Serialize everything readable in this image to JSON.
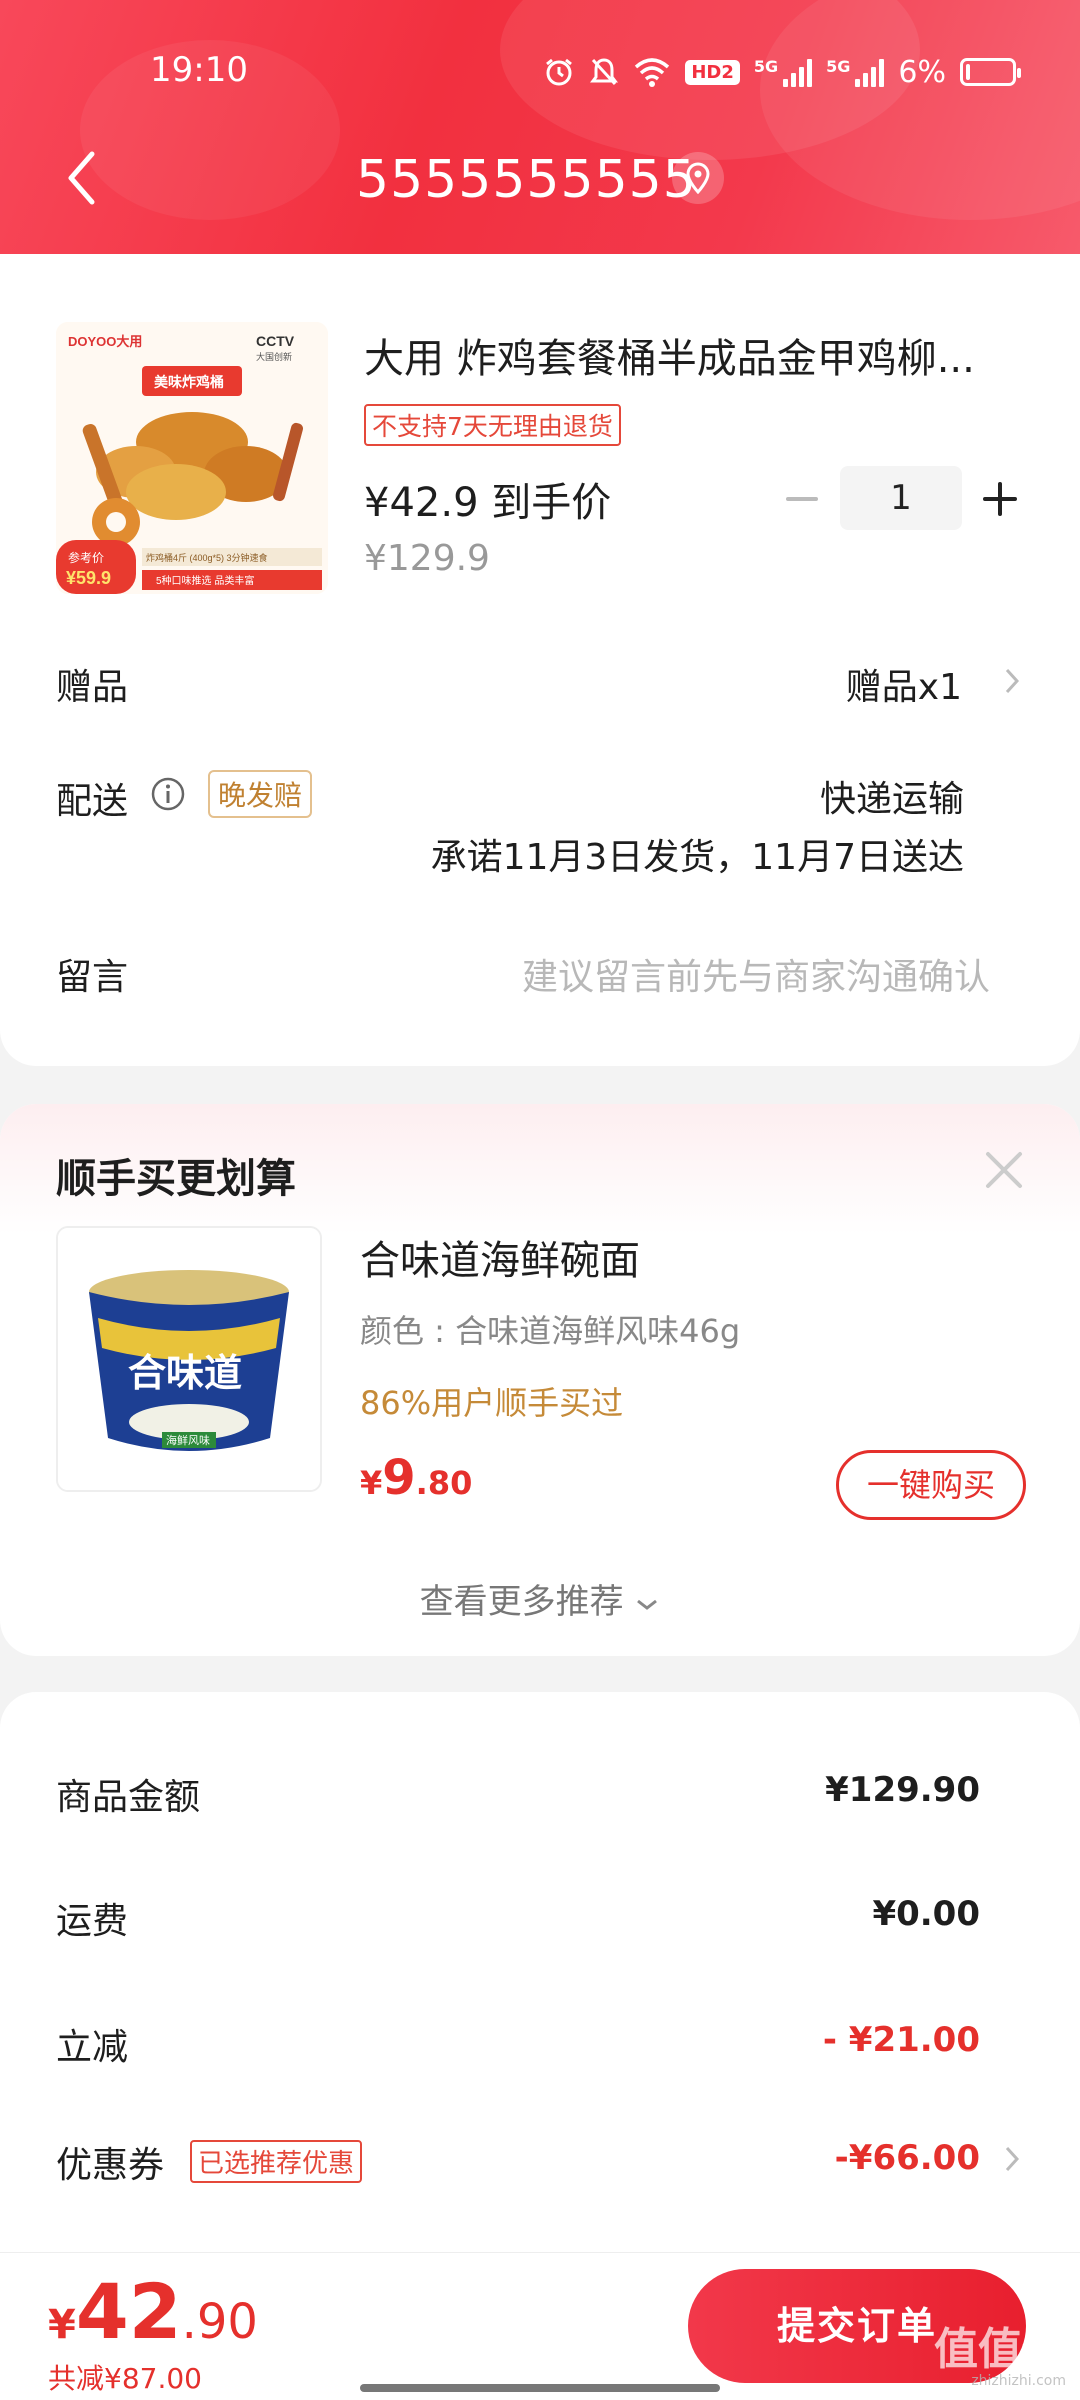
{
  "status_bar": {
    "time": "19:10",
    "icons": [
      "alarm-icon",
      "mute-icon",
      "wifi-icon",
      "hd-icon",
      "signal-5g-icon",
      "signal-5g-icon",
      "battery-icon"
    ],
    "hd_label": "HD2",
    "sig_label": "5G",
    "battery_text": "6%"
  },
  "header": {
    "title": "5555555555",
    "colors": {
      "primary": "#f2303f"
    }
  },
  "product": {
    "title": "大用 炸鸡套餐桶半成品金甲鸡柳...",
    "no_return_tag": "不支持7天无理由退货",
    "price_main": "¥42.9 到手价",
    "price_original": "¥129.9",
    "quantity": "1",
    "image": {
      "brand_left": "DOYOO大用",
      "brand_right": "CCTV",
      "brand_right_sub": "大国创新",
      "banner": "美味炸鸡桶",
      "ref_label": "参考价",
      "ref_price": "¥59.9",
      "strip1": "炸鸡桶4斤 (400g*5)  3分钟速食",
      "strip2": "5种口味推选 品类丰富"
    }
  },
  "order_rows": {
    "gift_label": "赠品",
    "gift_value": "赠品x1",
    "delivery_label": "配送",
    "delivery_badge": "晚发赔",
    "delivery_method": "快递运输",
    "delivery_promise": "承诺11月3日发货，11月7日送达",
    "remark_label": "留言",
    "remark_placeholder": "建议留言前先与商家沟通确认"
  },
  "recommend": {
    "title": "顺手买更划算",
    "item_name": "合味道海鲜碗面",
    "item_spec": "颜色 : 合味道海鲜风味46g",
    "item_bought": "86%用户顺手买过",
    "price_symbol": "¥",
    "price_int": "9",
    "price_dec": ".80",
    "buy_label": "一键购买",
    "more_label": "查看更多推荐",
    "cup_brand": "合味道",
    "cup_flavor": "海鲜风味"
  },
  "summary": {
    "goods_label": "商品金额",
    "goods_value": "¥129.90",
    "shipping_label": "运费",
    "shipping_value": "¥0.00",
    "discount_label": "立减",
    "discount_value": "- ¥21.00",
    "coupon_label": "优惠券",
    "coupon_tag": "已选推荐优惠",
    "coupon_value": "-¥66.00"
  },
  "bottom": {
    "price_symbol": "¥",
    "price_int": "42",
    "price_dec": ".90",
    "saving": "共减¥87.00",
    "submit_label": "提交订单",
    "watermark": "值值值",
    "watermark_sub": "zhizhizhi.com"
  }
}
